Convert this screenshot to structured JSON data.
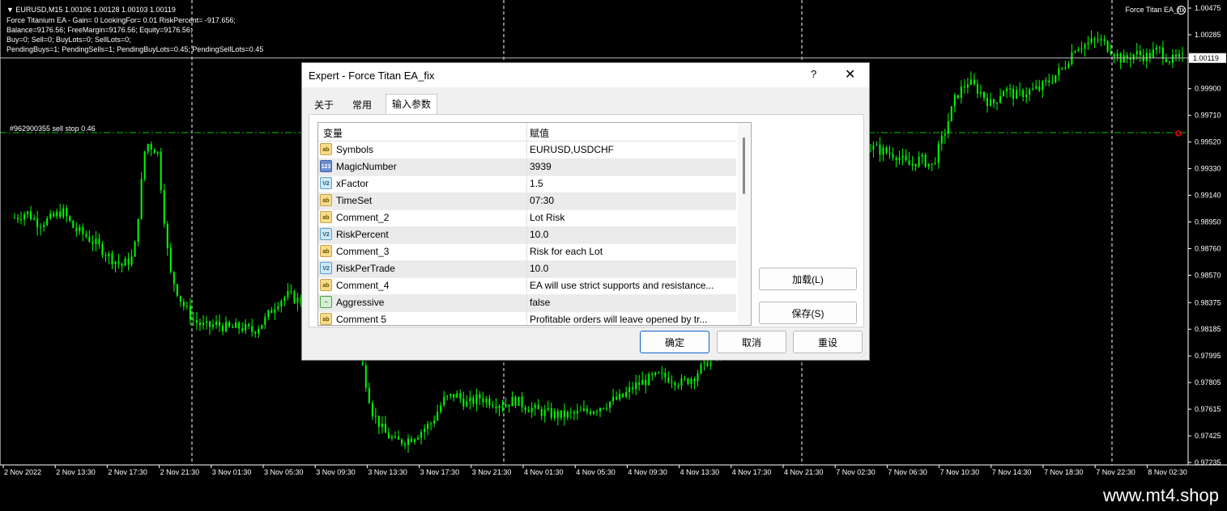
{
  "chart": {
    "header_lines": [
      "▼ EURUSD,M15  1.00106 1.00128 1.00103 1.00119",
      "Force Titanium EA - Gain= 0 LookingFor= 0.01 RiskPercent= -917.656;",
      "Balance=9176.56; FreeMargin=9176.56; Equity=9176.56;",
      "Buy=0; Sell=0; BuyLots=0; SellLots=0;",
      "PendingBuys=1; PendingSells=1; PendingBuyLots=0.45; PendingSellLots=0.45"
    ],
    "ea_label": "Force Titan EA_fix",
    "order_label": "#962900355 sell stop 0.46",
    "current_price": "1.00119",
    "price_ticks": [
      "1.00475",
      "1.00285",
      "1.00119",
      "0.99900",
      "0.99710",
      "0.99520",
      "0.99330",
      "0.99140",
      "0.98950",
      "0.98760",
      "0.98570",
      "0.98375",
      "0.98185",
      "0.97995",
      "0.97805",
      "0.97615",
      "0.97425",
      "0.97235"
    ],
    "time_ticks": [
      "2 Nov 2022",
      "2 Nov 13:30",
      "2 Nov 17:30",
      "2 Nov 21:30",
      "3 Nov 01:30",
      "3 Nov 05:30",
      "3 Nov 09:30",
      "3 Nov 13:30",
      "3 Nov 17:30",
      "3 Nov 21:30",
      "4 Nov 01:30",
      "4 Nov 05:30",
      "4 Nov 09:30",
      "4 Nov 13:30",
      "4 Nov 17:30",
      "4 Nov 21:30",
      "7 Nov 02:30",
      "7 Nov 06:30",
      "7 Nov 10:30",
      "7 Nov 14:30",
      "7 Nov 18:30",
      "7 Nov 22:30",
      "8 Nov 02:30"
    ],
    "colors": {
      "background": "#000000",
      "candle": "#00ff00",
      "text": "#ffffff",
      "grid": "#ffffff",
      "order_line": "#00c800",
      "order_marker": "#ff0000"
    },
    "series_close": [
      0.9898,
      0.9902,
      0.9894,
      0.9897,
      0.9903,
      0.989,
      0.9885,
      0.9878,
      0.987,
      0.9864,
      0.987,
      0.9952,
      0.9945,
      0.986,
      0.9838,
      0.9825,
      0.982,
      0.9822,
      0.9819,
      0.982,
      0.9817,
      0.9825,
      0.9838,
      0.9843,
      0.9838,
      0.984,
      0.9837,
      0.9832,
      0.982,
      0.98,
      0.976,
      0.9745,
      0.9738,
      0.974,
      0.9745,
      0.9752,
      0.9768,
      0.9772,
      0.9765,
      0.977,
      0.9767,
      0.9765,
      0.9768,
      0.9763,
      0.976,
      0.9758,
      0.9757,
      0.9758,
      0.976,
      0.9763,
      0.9767,
      0.977,
      0.9778,
      0.9782,
      0.9785,
      0.9784,
      0.978,
      0.9785,
      0.9795,
      0.98,
      0.9905,
      0.9912,
      0.9918,
      0.9925,
      0.9935,
      0.994,
      0.9945,
      0.9948,
      0.9942,
      0.9938,
      0.9945,
      0.995,
      0.9948,
      0.9945,
      0.9943,
      0.9935,
      0.994,
      0.9935,
      0.9958,
      0.9985,
      0.9995,
      0.9988,
      0.9978,
      0.999,
      0.9985,
      0.9988,
      0.999,
      0.9997,
      1.0005,
      1.002,
      1.0022,
      1.0025,
      1.0018,
      1.001,
      1.0015,
      1.0013,
      1.0018,
      1.001,
      1.0012
    ]
  },
  "dialog": {
    "title": "Expert - Force Titan EA_fix",
    "help": "?",
    "close": "✕",
    "tabs": [
      "关于",
      "常用",
      "输入参数"
    ],
    "columns": {
      "variable": "变量",
      "value": "赋值"
    },
    "params": [
      {
        "type": "ab",
        "name": "Symbols",
        "value": "EURUSD,USDCHF"
      },
      {
        "type": "num",
        "name": "MagicNumber",
        "value": "3939"
      },
      {
        "type": "dbl",
        "name": "xFactor",
        "value": "1.5"
      },
      {
        "type": "ab",
        "name": "TimeSet",
        "value": "07:30"
      },
      {
        "type": "ab",
        "name": "Comment_2",
        "value": "Lot Risk"
      },
      {
        "type": "dbl",
        "name": "RiskPercent",
        "value": "10.0"
      },
      {
        "type": "ab",
        "name": "Comment_3",
        "value": "Risk for each Lot"
      },
      {
        "type": "dbl",
        "name": "RiskPerTrade",
        "value": "10.0"
      },
      {
        "type": "ab",
        "name": "Comment_4",
        "value": "EA will use strict supports and resistance..."
      },
      {
        "type": "bool",
        "name": "Aggressive",
        "value": "false"
      },
      {
        "type": "ab",
        "name": "Comment 5",
        "value": "Profitable orders will leave opened by tr..."
      }
    ],
    "icon_text": {
      "ab": "ab",
      "num": "123",
      "dbl": "V2",
      "bool": "~"
    },
    "buttons": {
      "load": "加载(L)",
      "save": "保存(S)",
      "ok": "确定",
      "cancel": "取消",
      "reset": "重设"
    }
  },
  "watermark": "www.mt4.shop"
}
